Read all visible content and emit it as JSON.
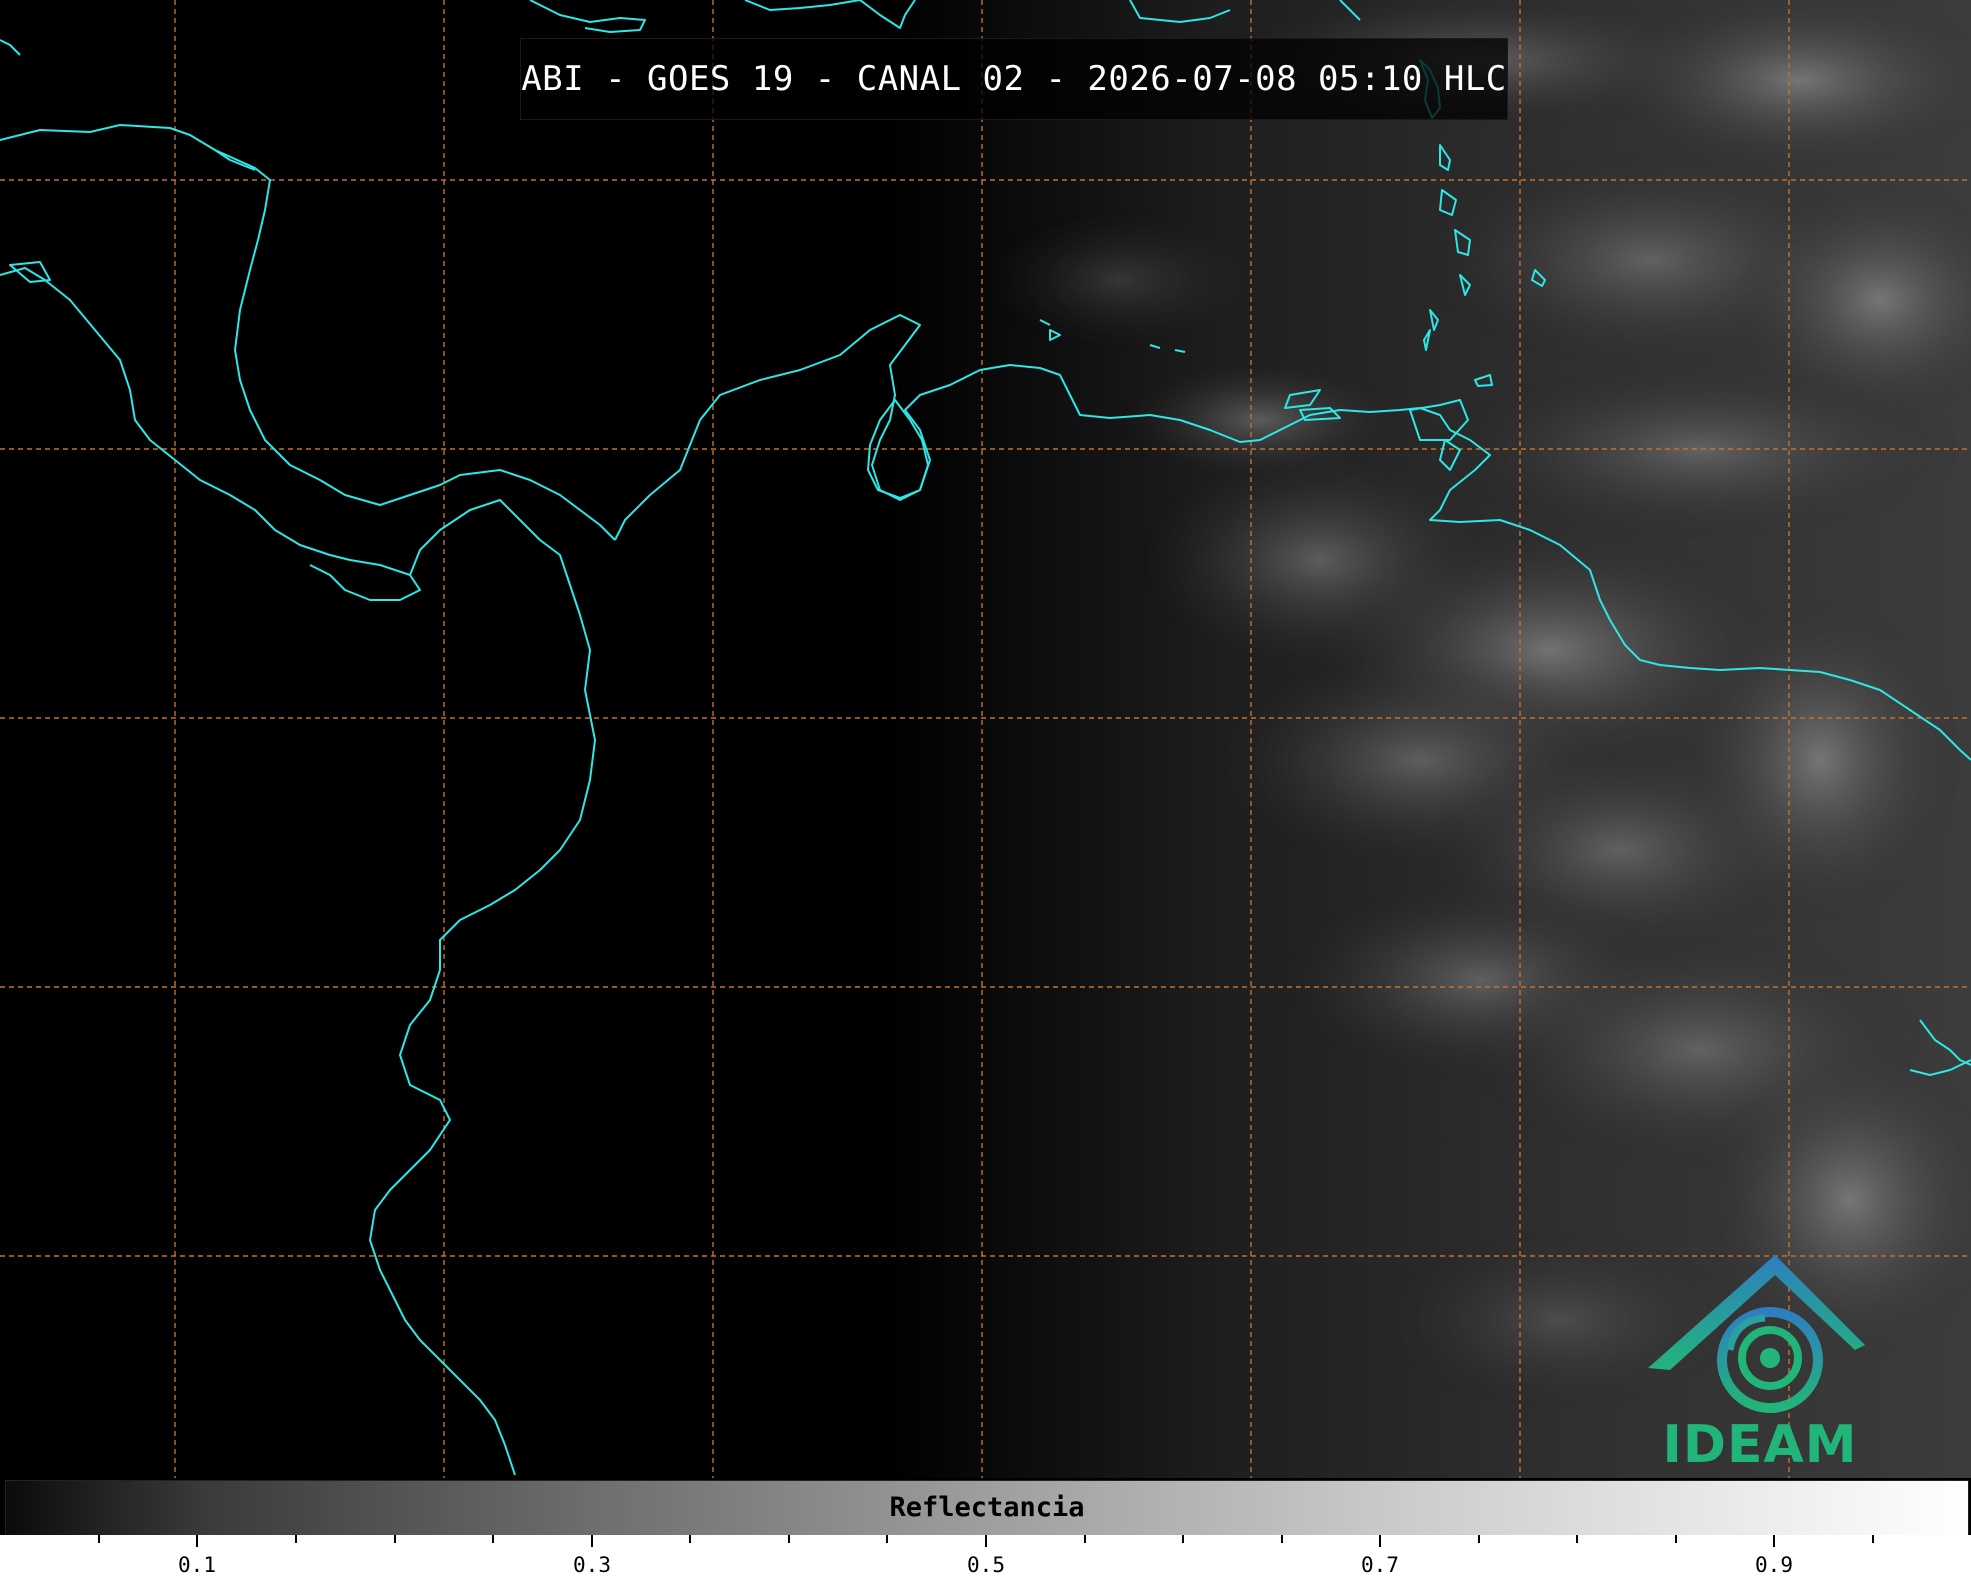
{
  "title": "ABI - GOES 19 - CANAL 02 - 2026-07-08 05:10 HLC",
  "logo": {
    "text": "IDEAM",
    "icon": "ideam-logo-icon"
  },
  "colorbar": {
    "title": "Reflectancia",
    "ticks": [
      {
        "label": "0.1"
      },
      {
        "label": "0.3"
      },
      {
        "label": "0.5"
      },
      {
        "label": "0.7"
      },
      {
        "label": "0.9"
      }
    ],
    "range": [
      0.0,
      1.0
    ]
  },
  "colors": {
    "coastline": "#2ee6e6",
    "gridlines": "#c8702a",
    "logo_blue": "#2e7fc0",
    "logo_green": "#22b57a"
  }
}
